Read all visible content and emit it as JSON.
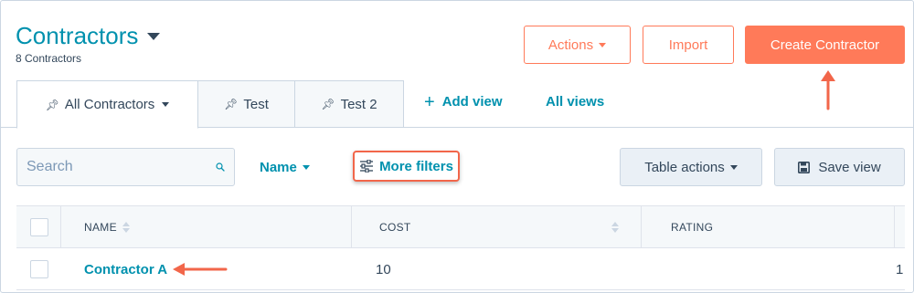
{
  "header": {
    "title": "Contractors",
    "subtitle": "8 Contractors",
    "actions_label": "Actions",
    "import_label": "Import",
    "create_label": "Create Contractor"
  },
  "tabs": [
    {
      "label": "All Contractors",
      "active": true
    },
    {
      "label": "Test",
      "active": false
    },
    {
      "label": "Test 2",
      "active": false
    }
  ],
  "view_links": {
    "add_view": "Add view",
    "all_views": "All views"
  },
  "toolbar": {
    "search_placeholder": "Search",
    "name_filter": "Name",
    "more_filters": "More filters",
    "table_actions": "Table actions",
    "save_view": "Save view"
  },
  "table": {
    "columns": [
      "NAME",
      "COST",
      "RATING"
    ],
    "rows": [
      {
        "name": "Contractor A",
        "cost": "10",
        "rating": "1"
      }
    ]
  },
  "colors": {
    "accent": "#ff7a59",
    "link": "#0091ae",
    "text": "#33475b",
    "annotation": "#f2664a"
  },
  "icons": {
    "search": "search-icon",
    "pin": "pin-icon",
    "filter": "sliders-icon",
    "save": "floppy-disk-icon"
  }
}
